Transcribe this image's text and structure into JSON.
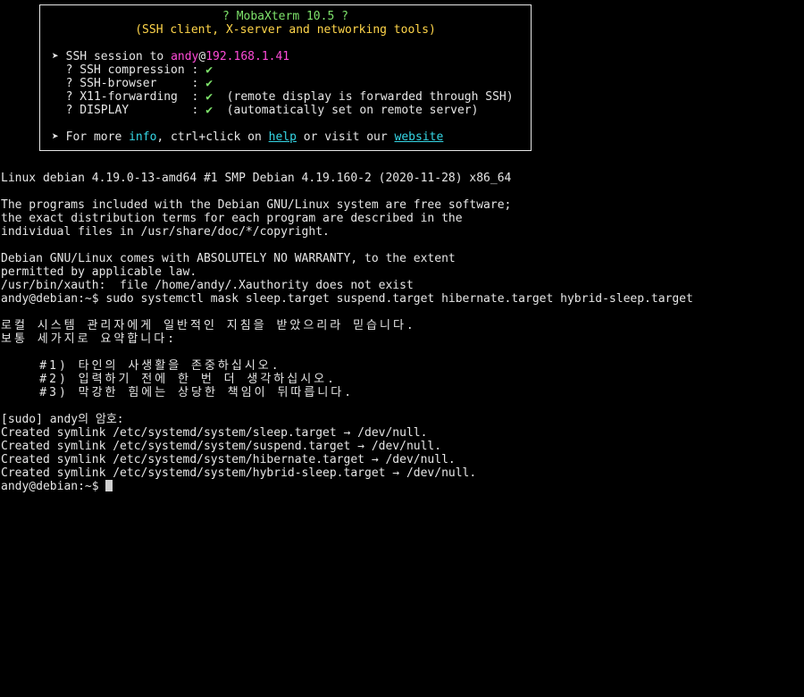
{
  "banner": {
    "title": "? MobaXterm 10.5 ?",
    "subtitle": "(SSH client, X-server and networking tools)",
    "session_prefix": "➤ SSH session to ",
    "session_user": "andy",
    "session_at": "@",
    "session_host": "192.168.1.41",
    "features": [
      {
        "label": "  ? SSH compression : ",
        "check": "✔",
        "note": ""
      },
      {
        "label": "  ? SSH-browser     : ",
        "check": "✔",
        "note": ""
      },
      {
        "label": "  ? X11-forwarding  : ",
        "check": "✔",
        "note": "  (remote display is forwarded through SSH)"
      },
      {
        "label": "  ? DISPLAY         : ",
        "check": "✔",
        "note": "  (automatically set on remote server)"
      }
    ],
    "more_prefix": "➤ For more ",
    "more_info": "info",
    "more_mid": ", ctrl+click on ",
    "more_help": "help",
    "more_or": " or visit our ",
    "more_website": "website"
  },
  "output": [
    "Linux debian 4.19.0-13-amd64 #1 SMP Debian 4.19.160-2 (2020-11-28) x86_64",
    "",
    "The programs included with the Debian GNU/Linux system are free software;",
    "the exact distribution terms for each program are described in the",
    "individual files in /usr/share/doc/*/copyright.",
    "",
    "Debian GNU/Linux comes with ABSOLUTELY NO WARRANTY, to the extent",
    "permitted by applicable law.",
    "/usr/bin/xauth:  file /home/andy/.Xauthority does not exist",
    "andy@debian:~$ sudo systemctl mask sleep.target suspend.target hibernate.target hybrid-sleep.target",
    "",
    "로컬 시스템 관리자에게 일반적인 지침을 받았으리라 믿습니다.",
    "보통 세가지로 요약합니다:",
    "",
    "    #1) 타인의 사생활을 존중하십시오.",
    "    #2) 입력하기 전에 한 번 더 생각하십시오.",
    "    #3) 막강한 힘에는 상당한 책임이 뒤따릅니다.",
    "",
    "[sudo] andy의 암호:",
    "Created symlink /etc/systemd/system/sleep.target → /dev/null.",
    "Created symlink /etc/systemd/system/suspend.target → /dev/null.",
    "Created symlink /etc/systemd/system/hibernate.target → /dev/null.",
    "Created symlink /etc/systemd/system/hybrid-sleep.target → /dev/null."
  ],
  "prompt": "andy@debian:~$ ",
  "colors": {
    "background": "#000000",
    "foreground": "#e6e6e6",
    "green": "#7ee36b",
    "yellow": "#ffd54a",
    "magenta": "#ff4bd8",
    "cyan": "#35d7e6"
  }
}
